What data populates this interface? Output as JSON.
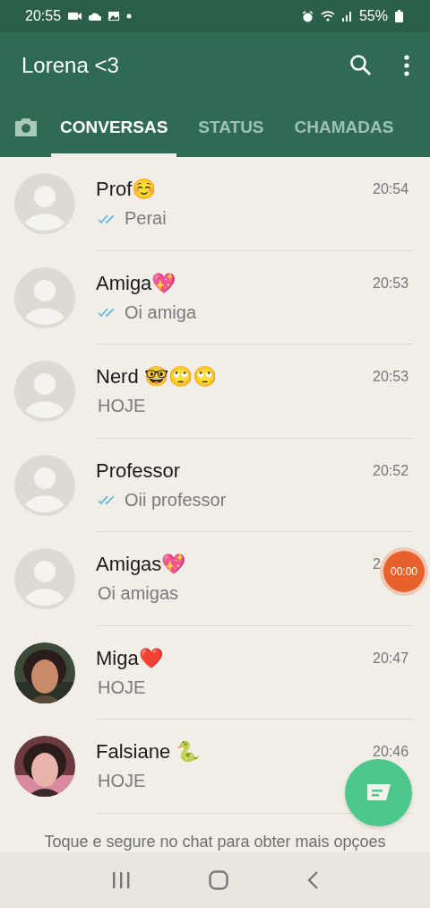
{
  "status_bar": {
    "time": "20:55",
    "battery": "55%"
  },
  "app_bar": {
    "title": "Lorena <3"
  },
  "tabs": [
    {
      "label": "CONVERSAS",
      "selected": true
    },
    {
      "label": "STATUS",
      "selected": false
    },
    {
      "label": "CHAMADAS",
      "selected": false
    }
  ],
  "chats": [
    {
      "name": "Prof☺️",
      "time": "20:54",
      "preview": "Perai",
      "read": true,
      "has_photo": false
    },
    {
      "name": "Amiga💖",
      "time": "20:53",
      "preview": "Oi amiga",
      "read": true,
      "has_photo": false
    },
    {
      "name": "Nerd 🤓🙄🙄",
      "time": "20:53",
      "preview": "HOJE",
      "read": false,
      "has_photo": false
    },
    {
      "name": "Professor",
      "time": "20:52",
      "preview": "Oii professor",
      "read": true,
      "has_photo": false
    },
    {
      "name": "Amigas💖",
      "time": "2",
      "preview": "Oi amigas",
      "read": false,
      "has_photo": false
    },
    {
      "name": "Miga❤️",
      "time": "20:47",
      "preview": "HOJE",
      "read": false,
      "has_photo": true
    },
    {
      "name": "Falsiane 🐍",
      "time": "20:46",
      "preview": "HOJE",
      "read": false,
      "has_photo": true
    }
  ],
  "recorder_bubble": {
    "label": "00:00"
  },
  "hint": "Toque e segure no chat para obter mais opçoes"
}
